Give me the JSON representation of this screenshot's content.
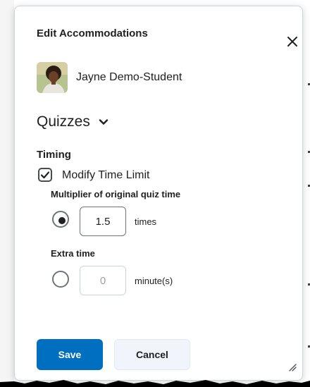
{
  "dialog": {
    "title": "Edit Accommodations",
    "close_icon": "close-icon"
  },
  "student": {
    "name": "Jayne Demo-Student",
    "avatar_icon": "avatar-photo"
  },
  "section": {
    "title": "Quizzes",
    "chevron_icon": "chevron-down-icon"
  },
  "timing": {
    "heading": "Timing",
    "modify_time_limit": {
      "label": "Modify Time Limit",
      "checked": true
    },
    "multiplier": {
      "label": "Multiplier of original quiz time",
      "selected": true,
      "value": "1.5",
      "unit": "times"
    },
    "extra_time": {
      "label": "Extra time",
      "selected": false,
      "value": "0",
      "unit": "minute(s)"
    }
  },
  "actions": {
    "save_label": "Save",
    "cancel_label": "Cancel"
  },
  "colors": {
    "primary": "#006fbf",
    "secondary_bg": "#f1f5fb",
    "text": "#202122"
  }
}
